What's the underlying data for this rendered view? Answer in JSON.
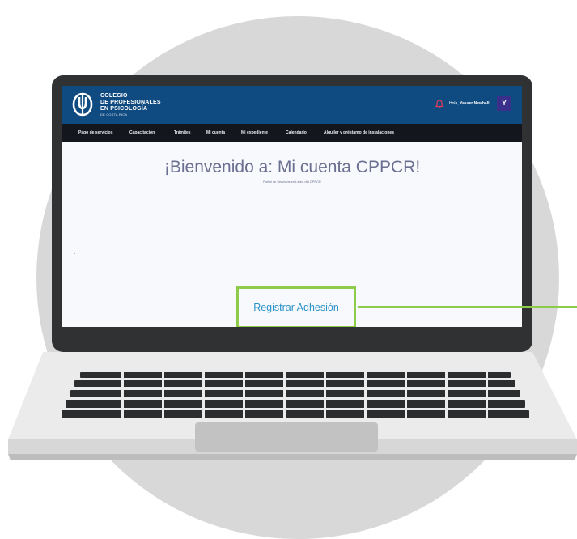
{
  "header": {
    "logo_lines": [
      "COLEGIO",
      "DE PROFESIONALES",
      "EN PSICOLOGÍA"
    ],
    "logo_small": "DE COSTA RICA",
    "greeting": "Hola,",
    "user_name": "Yasser Newball",
    "avatar_initial": "Y"
  },
  "nav": {
    "items": [
      "Pago de servicios",
      "Capacitación",
      "Trámites",
      "Mi cuenta",
      "Mi expediente",
      "Calendario",
      "Alquiler y préstamo de instalaciones"
    ]
  },
  "main": {
    "title": "¡Bienvenido a: Mi cuenta CPPCR!",
    "subtitle": "Portal de Servicios en Línea del CPPCR"
  },
  "callout": {
    "label": "Registrar Adhesión",
    "color": "#8ccc4a"
  },
  "colors": {
    "topbar": "#0f4a80",
    "navbar": "#13161d",
    "title": "#6b6f91",
    "link": "#2a93c9",
    "avatar": "#3b2f8c",
    "bell": "#e23b5a"
  }
}
